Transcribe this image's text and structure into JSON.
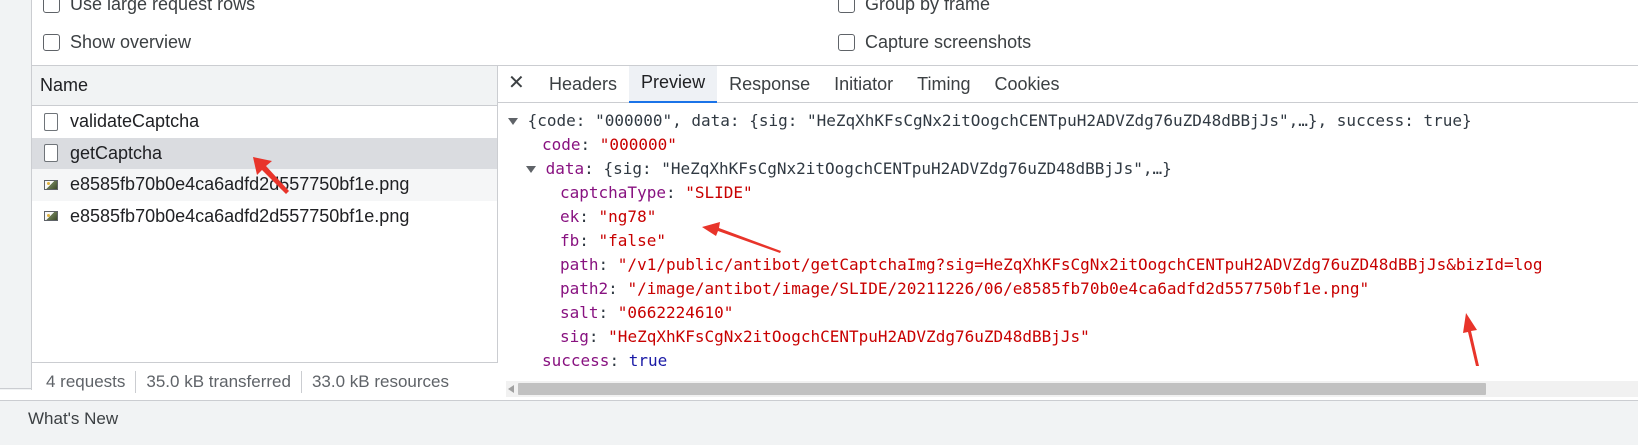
{
  "settings": {
    "use_large_rows": "Use large request rows",
    "show_overview": "Show overview",
    "group_by_frame": "Group by frame",
    "capture_screenshots": "Capture screenshots"
  },
  "request_list": {
    "header": "Name",
    "rows": [
      {
        "name": "validateCaptcha",
        "icon": "document-icon"
      },
      {
        "name": "getCaptcha",
        "icon": "document-icon"
      },
      {
        "name": "e8585fb70b0e4ca6adfd2d557750bf1e.png",
        "icon": "image-icon"
      },
      {
        "name": "e8585fb70b0e4ca6adfd2d557750bf1e.png",
        "icon": "image-icon"
      }
    ],
    "status": {
      "requests": "4 requests",
      "transferred": "35.0 kB transferred",
      "resources": "33.0 kB resources"
    }
  },
  "detail": {
    "close": "✕",
    "tabs": [
      "Headers",
      "Preview",
      "Response",
      "Initiator",
      "Timing",
      "Cookies"
    ],
    "active_tab": "Preview",
    "preview": {
      "summary": "{code: \"000000\", data: {sig: \"HeZqXhKFsCgNx2itOogchCENTpuH2ADVZdg76uZD48dBBjJs\",…}, success: true}",
      "code_key": "code",
      "code_val": "\"000000\"",
      "data_key": "data",
      "data_summary": "{sig: \"HeZqXhKFsCgNx2itOogchCENTpuH2ADVZdg76uZD48dBBjJs\",…}",
      "fields": [
        {
          "key": "captchaType",
          "value": "\"SLIDE\""
        },
        {
          "key": "ek",
          "value": "\"ng78\""
        },
        {
          "key": "fb",
          "value": "\"false\""
        },
        {
          "key": "path",
          "value": "\"/v1/public/antibot/getCaptchaImg?sig=HeZqXhKFsCgNx2itOogchCENTpuH2ADVZdg76uZD48dBBjJs&bizId=log"
        },
        {
          "key": "path2",
          "value": "\"/image/antibot/image/SLIDE/20211226/06/e8585fb70b0e4ca6adfd2d557750bf1e.png\""
        },
        {
          "key": "salt",
          "value": "\"0662224610\""
        },
        {
          "key": "sig",
          "value": "\"HeZqXhKFsCgNx2itOogchCENTpuH2ADVZdg76uZD48dBBjJs\""
        }
      ],
      "success_key": "success",
      "success_val": "true"
    }
  },
  "drawer": {
    "tab": "What's New"
  },
  "colors": {
    "accent": "#1a73e8",
    "json_key": "#881280",
    "json_string": "#c80000",
    "json_bool": "#1a1aa6",
    "annotation": "#e8342a"
  }
}
